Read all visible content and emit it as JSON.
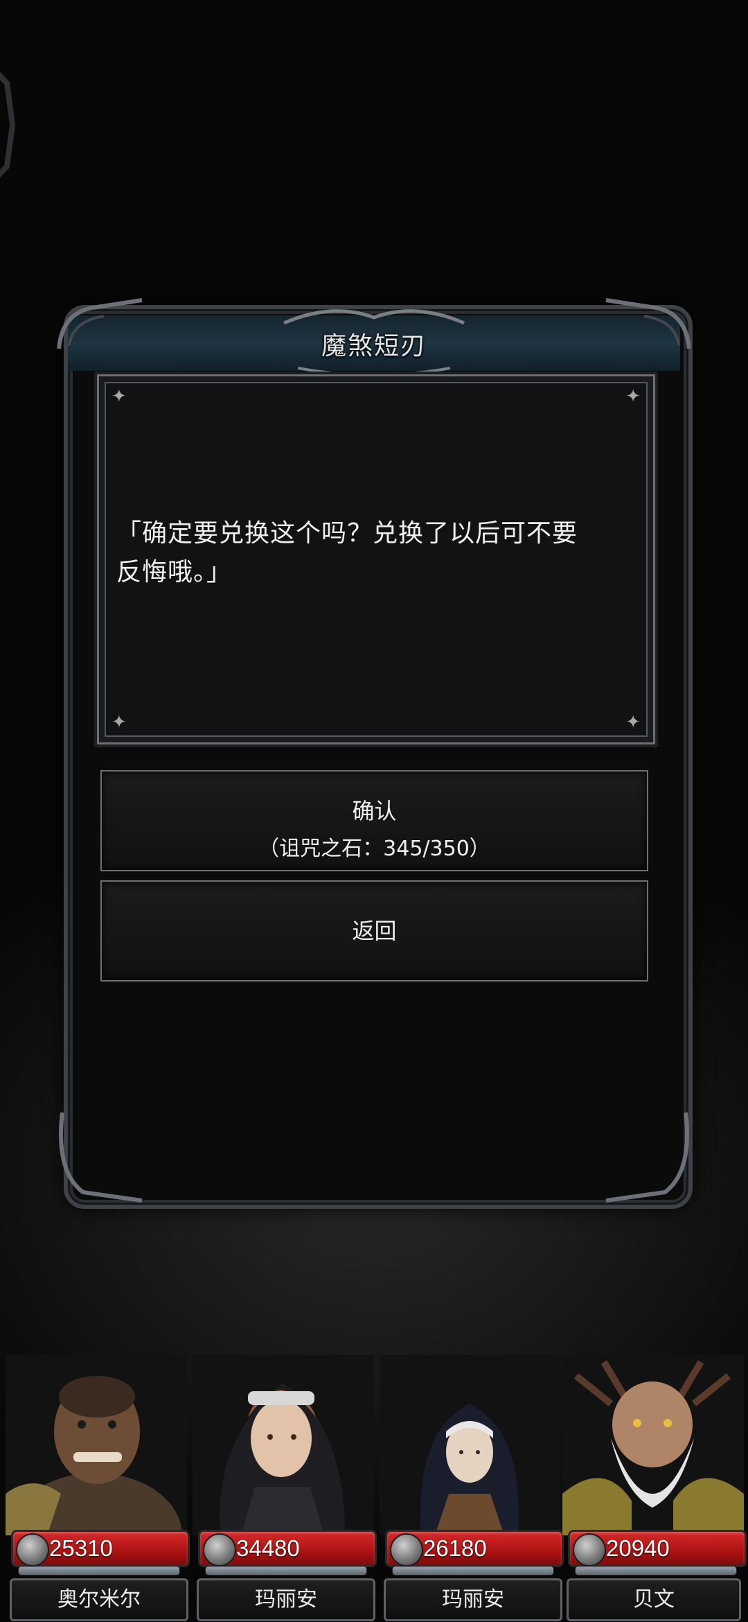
{
  "dialog": {
    "title": "魔煞短刃",
    "message_line1": "「确定要兑换这个吗？兑换了以后可不要",
    "message_line2": "反悔哦。」"
  },
  "confirm_button": {
    "label": "确认",
    "cost_text": "（诅咒之石：345/350）"
  },
  "back_button": {
    "label": "返回"
  },
  "party": [
    {
      "hp": "25310",
      "name": "奥尔米尔"
    },
    {
      "hp": "34480",
      "name": "玛丽安"
    },
    {
      "hp": "26180",
      "name": "玛丽安"
    },
    {
      "hp": "20940",
      "name": "贝文"
    }
  ],
  "colors": {
    "hp_bar": "#b01414",
    "title_bar": "#1e3542",
    "frame": "#3e4146"
  }
}
